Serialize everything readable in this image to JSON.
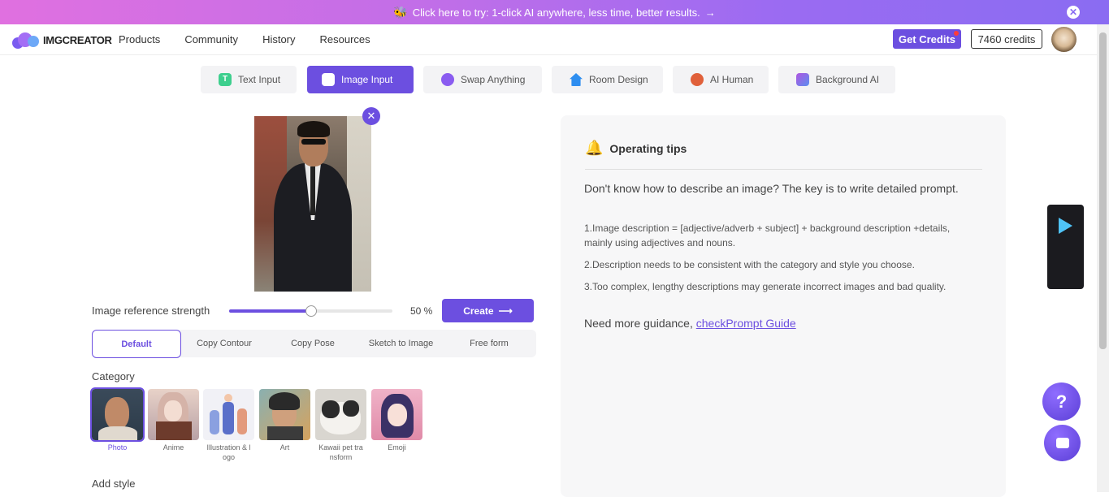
{
  "banner": {
    "icon": "bee-icon",
    "text": "Click here to try: 1-click AI anywhere, less time, better results.",
    "arrow": "→",
    "close": "✕"
  },
  "logo": {
    "text": "IMGCREATOR"
  },
  "nav": {
    "links": [
      "Products",
      "Community",
      "History",
      "Resources"
    ]
  },
  "account": {
    "get_credits": "Get Credits",
    "credits": "7460 credits"
  },
  "tabs": [
    {
      "label": "Text Input",
      "icon": "text-icon",
      "color": "#3ecf8e"
    },
    {
      "label": "Image Input",
      "icon": "image-icon",
      "color": "#ffffff"
    },
    {
      "label": "Swap Anything",
      "icon": "palette-icon",
      "color": "#8a5cf0"
    },
    {
      "label": "Room Design",
      "icon": "house-icon",
      "color": "#2e8ef0"
    },
    {
      "label": "AI Human",
      "icon": "face-icon",
      "color": "#e0603a"
    },
    {
      "label": "Background AI",
      "icon": "layers-icon",
      "color": "#b055e0"
    }
  ],
  "image_panel": {
    "remove": "✕",
    "strength_label": "Image reference strength",
    "strength_value": "50 %",
    "strength": 0.5,
    "create": "Create",
    "create_arrow": "⟶"
  },
  "modes": [
    "Default",
    "Copy Contour",
    "Copy Pose",
    "Sketch to Image",
    "Free form"
  ],
  "category": {
    "title": "Category",
    "items": [
      {
        "label": "Photo"
      },
      {
        "label": "Anime"
      },
      {
        "label": "Illustration & l ogo"
      },
      {
        "label": "Art"
      },
      {
        "label": "Kawaii pet tra nsform"
      },
      {
        "label": "Emoji"
      }
    ]
  },
  "add_style": "Add style",
  "tips": {
    "title": "Operating tips",
    "intro": "Don't know how to describe an image? The key is to write detailed prompt.",
    "items": [
      "1.Image description = [adjective/adverb + subject] + background description +details, mainly using adjectives and nouns.",
      "2.Description needs to be consistent with the category and style you choose.",
      "3.Too complex, lengthy descriptions may generate incorrect images and bad quality."
    ],
    "guidance_prefix": "Need more guidance, ",
    "guidance_link": "checkPrompt Guide"
  },
  "store": {
    "play": "google-play-icon",
    "apple": ""
  },
  "help": {
    "label": "?"
  },
  "colors": {
    "accent": "#6c4fe0"
  }
}
